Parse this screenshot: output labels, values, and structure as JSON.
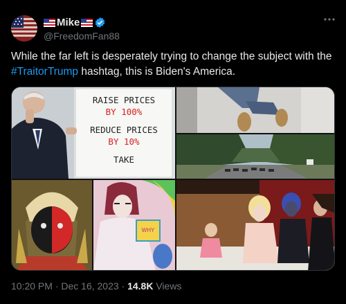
{
  "author": {
    "display_name": "Mike",
    "handle": "@FreedomFan88",
    "verified_icon": "verified-badge-icon",
    "flag_icon": "us-flag-icon"
  },
  "more_icon": "more-options-icon",
  "tweet": {
    "text_before": "While the far left is desperately trying to change the subject with the ",
    "hashtag": "#TraitorTrump",
    "text_after": " hashtag, this is Biden's America."
  },
  "media": {
    "sign_lines": [
      "RAISE PRICES",
      "BY 100%",
      "REDUCE PRICES",
      "BY 10%",
      "TAKE"
    ],
    "sign_highlight_color": "#d62020",
    "book_text": "WHY"
  },
  "footer": {
    "time": "10:20 PM · Dec 16, 2023 · ",
    "views_count": "14.8K",
    "views_label": " Views"
  },
  "colors": {
    "background": "#000000",
    "text": "#e7e9ea",
    "muted": "#71767b",
    "link": "#1d9bf0",
    "verified": "#1d9bf0"
  }
}
